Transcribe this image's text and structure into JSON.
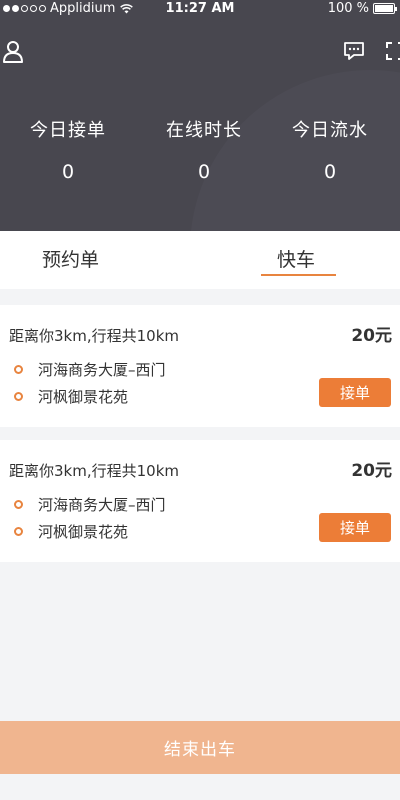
{
  "status_bar": {
    "carrier": "Applidium",
    "time": "11:27 AM",
    "battery": "100 %"
  },
  "header": {
    "icons": [
      "user-icon",
      "message-icon",
      "scan-icon"
    ],
    "stats": [
      {
        "label": "今日接单",
        "value": "0"
      },
      {
        "label": "在线时长",
        "value": "0"
      },
      {
        "label": "今日流水",
        "value": "0"
      }
    ]
  },
  "tabs": {
    "items": [
      {
        "label": "预约单"
      },
      {
        "label": "快车"
      }
    ],
    "active_index": 1
  },
  "orders": [
    {
      "distance": "距离你3km,行程共10km",
      "price": "20元",
      "from": "河海商务大厦–西门",
      "to": "河枫御景花苑",
      "accept_label": "接单"
    },
    {
      "distance": "距离你3km,行程共10km",
      "price": "20元",
      "from": "河海商务大厦–西门",
      "to": "河枫御景花苑",
      "accept_label": "接单"
    }
  ],
  "footer": {
    "end_label": "结束出车"
  },
  "colors": {
    "header_bg": "#48474f",
    "accent": "#ec7d37",
    "end_button": "#f0b58f"
  }
}
